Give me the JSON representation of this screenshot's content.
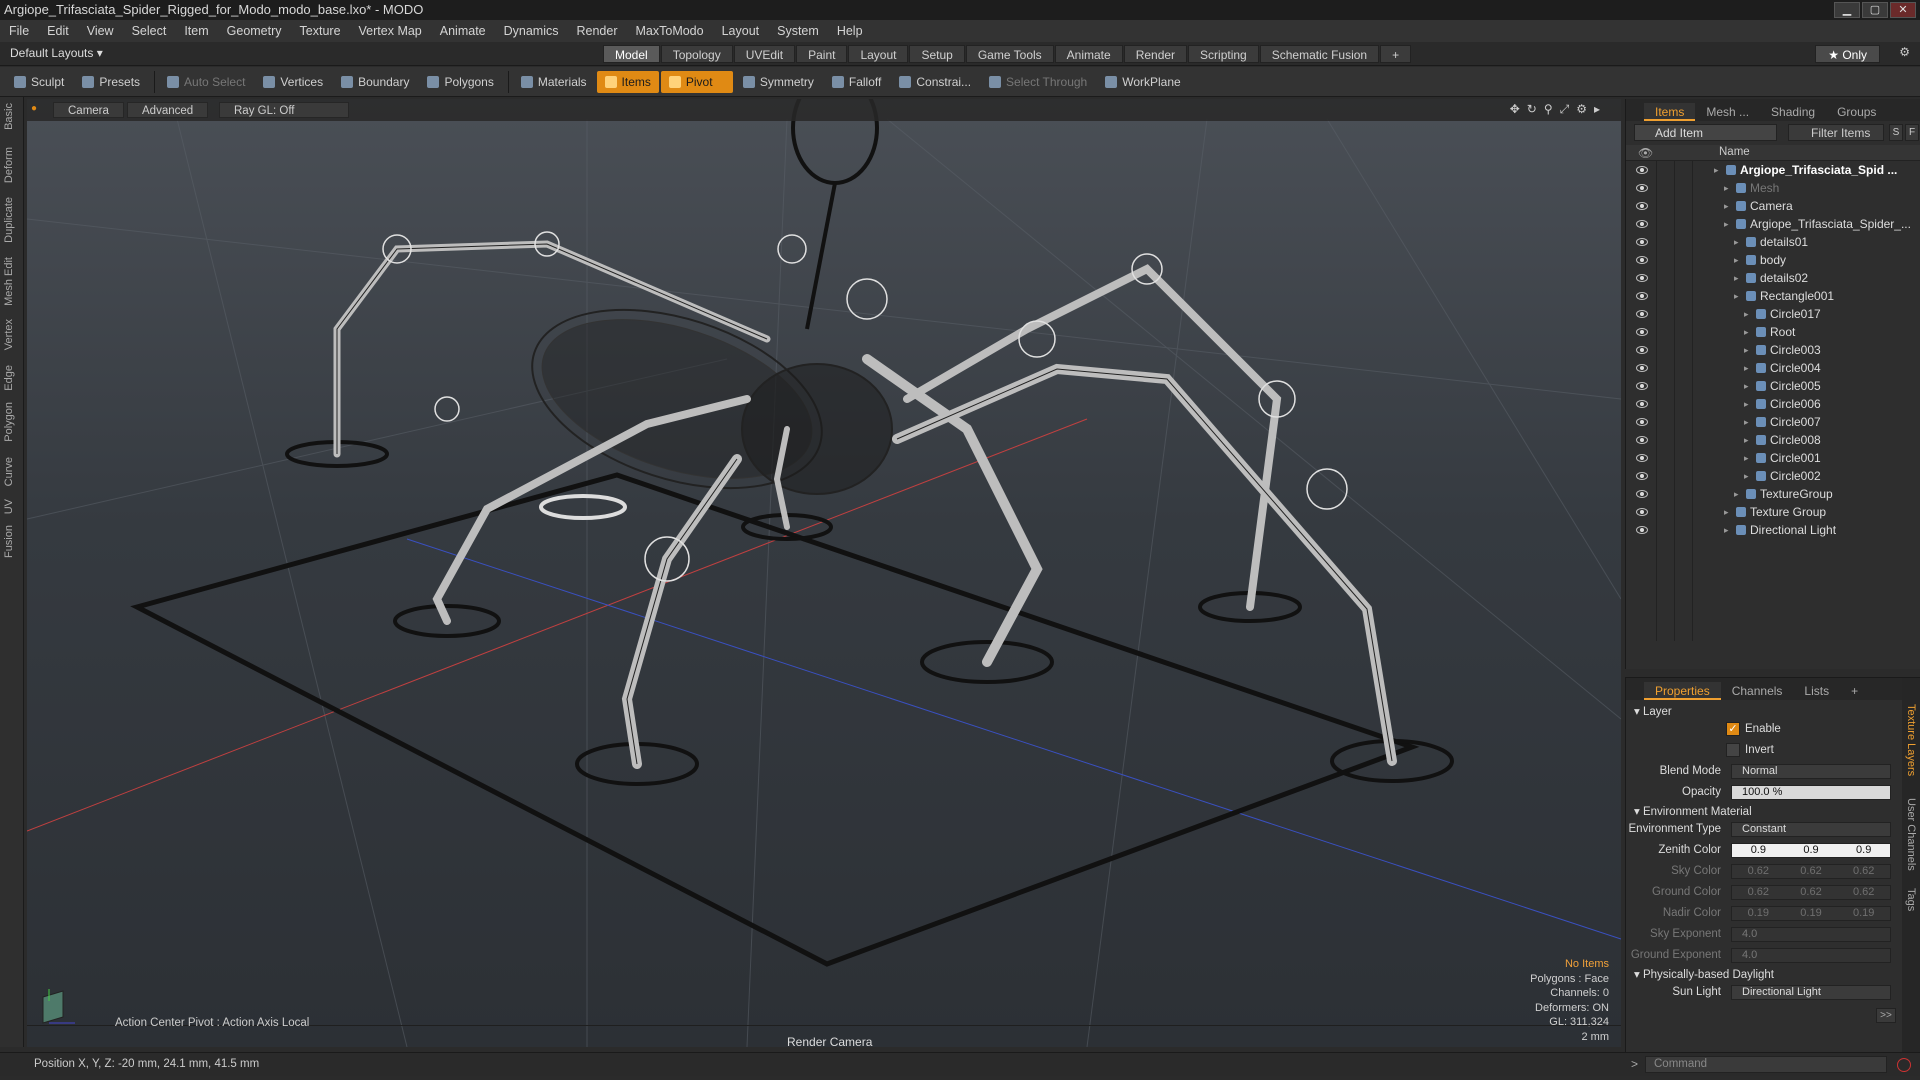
{
  "window": {
    "title": "Argiope_Trifasciata_Spider_Rigged_for_Modo_modo_base.lxo* - MODO",
    "btn_min": "▁",
    "btn_max": "▢",
    "btn_close": "✕"
  },
  "menu": [
    "File",
    "Edit",
    "View",
    "Select",
    "Item",
    "Geometry",
    "Texture",
    "Vertex Map",
    "Animate",
    "Dynamics",
    "Render",
    "MaxToModo",
    "Layout",
    "System",
    "Help"
  ],
  "layoutbar": {
    "layout_dropdown": "Default Layouts ▾",
    "tabs": [
      "Model",
      "Topology",
      "UVEdit",
      "Paint",
      "Layout",
      "Setup",
      "Game Tools",
      "Animate",
      "Render",
      "Scripting",
      "Schematic Fusion"
    ],
    "active_tab": "Model",
    "add_tab": "+",
    "only_btn": "★ Only"
  },
  "toolbar": {
    "sculpt": "Sculpt",
    "presets": "Presets",
    "auto_select": "Auto Select",
    "vertices": "Vertices",
    "boundary": "Boundary",
    "polygons": "Polygons",
    "materials": "Materials",
    "items": "Items",
    "pivot": "Pivot",
    "symmetry": "Symmetry",
    "falloff": "Falloff",
    "constraints": "Constrai...",
    "select_through": "Select Through",
    "workplane": "WorkPlane"
  },
  "left_tabs": [
    "Basic",
    "Deform",
    "Duplicate",
    "Mesh Edit",
    "Vertex",
    "Edge",
    "Polygon",
    "Curve",
    "UV",
    "Fusion"
  ],
  "viewport": {
    "camera_btn": "Camera",
    "advanced_btn": "Advanced",
    "raygl_btn": "Ray GL: Off",
    "info_items": "No Items",
    "info_lines": [
      "Polygons : Face",
      "Channels: 0",
      "Deformers: ON",
      "GL: 311,324",
      "2 mm"
    ],
    "action_center": "Action Center Pivot : Action Axis Local",
    "render_camera": "Render Camera"
  },
  "statusbar": {
    "position": "Position X, Y, Z:  -20 mm, 24.1 mm, 41.5 mm"
  },
  "items_panel": {
    "tabs": [
      "Items",
      "Mesh ...",
      "Shading",
      "Groups"
    ],
    "add_item": "Add Item",
    "filter_items": "Filter Items",
    "s_btn": "S",
    "f_btn": "F",
    "name_header": "Name",
    "tree": [
      {
        "label": "Argiope_Trifasciata_Spid ...",
        "indent": 0,
        "bold": true
      },
      {
        "label": "Mesh",
        "indent": 1,
        "dim": true
      },
      {
        "label": "Camera",
        "indent": 1
      },
      {
        "label": "Argiope_Trifasciata_Spider_...",
        "indent": 1
      },
      {
        "label": "details01",
        "indent": 2
      },
      {
        "label": "body",
        "indent": 2
      },
      {
        "label": "details02",
        "indent": 2
      },
      {
        "label": "Rectangle001",
        "indent": 2
      },
      {
        "label": "Circle017",
        "indent": 3
      },
      {
        "label": "Root",
        "indent": 3
      },
      {
        "label": "Circle003",
        "indent": 3
      },
      {
        "label": "Circle004",
        "indent": 3
      },
      {
        "label": "Circle005",
        "indent": 3
      },
      {
        "label": "Circle006",
        "indent": 3
      },
      {
        "label": "Circle007",
        "indent": 3
      },
      {
        "label": "Circle008",
        "indent": 3
      },
      {
        "label": "Circle001",
        "indent": 3
      },
      {
        "label": "Circle002",
        "indent": 3
      },
      {
        "label": "TextureGroup",
        "indent": 2
      },
      {
        "label": "Texture Group",
        "indent": 1
      },
      {
        "label": "Directional Light",
        "indent": 1
      }
    ]
  },
  "properties_panel": {
    "tabs": [
      "Properties",
      "Channels",
      "Lists",
      "+"
    ],
    "side_tabs": [
      "Texture Layers",
      "User Channels",
      "Tags"
    ],
    "layer_section": "Layer",
    "enable": "Enable",
    "invert": "Invert",
    "blend_mode_label": "Blend Mode",
    "blend_mode": "Normal",
    "opacity_label": "Opacity",
    "opacity": "100.0 %",
    "env_section": "Environment Material",
    "env_type_label": "Environment Type",
    "env_type": "Constant",
    "zenith_label": "Zenith Color",
    "zenith": [
      "0.9",
      "0.9",
      "0.9"
    ],
    "sky_label": "Sky Color",
    "sky": [
      "0.62",
      "0.62",
      "0.62"
    ],
    "ground_label": "Ground Color",
    "ground": [
      "0.62",
      "0.62",
      "0.62"
    ],
    "nadir_label": "Nadir Color",
    "nadir": [
      "0.19",
      "0.19",
      "0.19"
    ],
    "sky_exp_label": "Sky Exponent",
    "sky_exp": "4.0",
    "ground_exp_label": "Ground Exponent",
    "ground_exp": "4.0",
    "daylight_section": "Physically-based Daylight",
    "sun_light_label": "Sun Light",
    "sun_light": "Directional Light",
    "more_btn": ">>"
  },
  "command": {
    "prompt": ">",
    "placeholder": "Command"
  }
}
